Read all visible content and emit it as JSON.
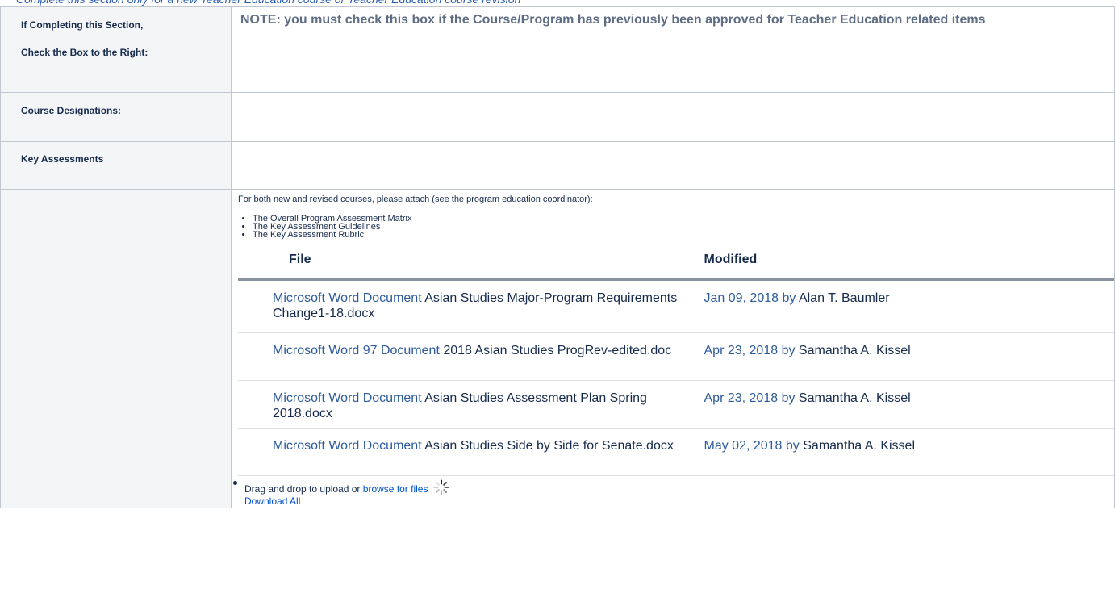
{
  "top_note": "Complete this section only for a new Teacher Education course or Teacher Education course revision",
  "rows": {
    "teacher_ed": {
      "header_line1": "If Completing this Section,",
      "header_line2": "Check the Box to the Right:",
      "note": "NOTE: you must check this box if the Course/Program has previously been approved for Teacher Education related items"
    },
    "designations": {
      "header": "Course Designations:"
    },
    "key_assessments": {
      "header": "Key Assessments"
    }
  },
  "attachments_section": {
    "intro": "For both new and revised courses, please attach (see the program education coordinator):",
    "items": [
      "The Overall Program Assessment Matrix",
      "The Key Assessment Guidelines",
      "The Key Assessment Rubric"
    ],
    "columns": {
      "file": "File",
      "modified": "Modified"
    },
    "files": [
      {
        "type": "Microsoft Word Document",
        "name": "Asian Studies Major-Program Requirements Change1-18.docx",
        "date": "Jan 09, 2018 by",
        "author": "Alan T. Baumler"
      },
      {
        "type": "Microsoft Word 97 Document",
        "name": "2018 Asian Studies ProgRev-edited.doc",
        "date": "Apr 23, 2018 by",
        "author": "Samantha A. Kissel"
      },
      {
        "type": "Microsoft Word Document",
        "name": "Asian Studies Assessment Plan Spring 2018.docx",
        "date": "Apr 23, 2018 by",
        "author": "Samantha A. Kissel"
      },
      {
        "type": "Microsoft Word Document",
        "name": "Asian Studies Side by Side for Senate.docx",
        "date": "May 02, 2018 by",
        "author": "Samantha A. Kissel"
      }
    ],
    "upload_text": "Drag and drop to upload or",
    "browse_link": "browse for files",
    "download_all": "Download All",
    "spinner_icon": "loading-spinner-icon"
  },
  "colors": {
    "link": "#2d5b9c",
    "header_bg": "#f4f5f7",
    "note_text": "#5e6c84",
    "italic_note": "#2a5db0"
  }
}
